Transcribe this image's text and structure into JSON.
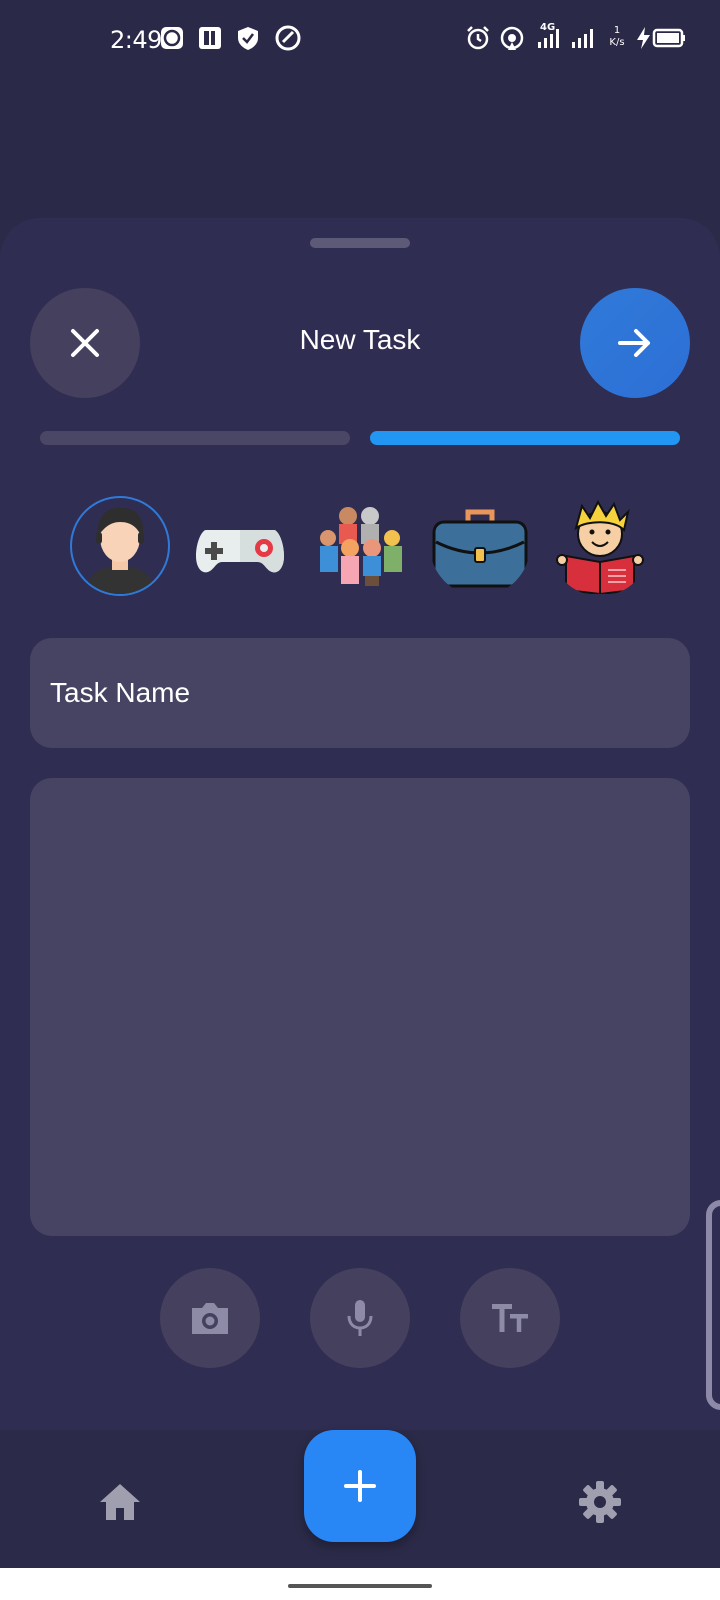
{
  "status_bar": {
    "time": "2:49",
    "network": "4G",
    "speed_value": "1",
    "speed_unit": "K/s",
    "icons": [
      "b-app-icon",
      "paytm-icon",
      "shield-icon",
      "vpn-icon",
      "alarm-icon",
      "hotspot-icon",
      "signal-icon",
      "signal-icon",
      "charging-icon",
      "battery-icon"
    ]
  },
  "sheet": {
    "title": "New Task",
    "close_icon": "close-icon",
    "next_icon": "arrow-right-icon",
    "progress": {
      "total_steps": 2,
      "current_step": 2
    },
    "categories": [
      {
        "name": "personal",
        "icon": "person-icon",
        "selected": true
      },
      {
        "name": "games",
        "icon": "gamepad-icon",
        "selected": false
      },
      {
        "name": "family",
        "icon": "family-icon",
        "selected": false
      },
      {
        "name": "work",
        "icon": "briefcase-icon",
        "selected": false
      },
      {
        "name": "study",
        "icon": "reading-icon",
        "selected": false
      }
    ],
    "task_name_placeholder": "Task Name",
    "task_body_placeholder": "",
    "media_buttons": [
      "camera-icon",
      "microphone-icon",
      "text-size-icon"
    ]
  },
  "bottom_nav": {
    "items": [
      "home-icon",
      "add-icon",
      "settings-icon"
    ]
  },
  "colors": {
    "background": "#2b2a48",
    "sheet": "#302d52",
    "field": "#474463",
    "accent": "#2196f3",
    "fab": "#2886f5"
  }
}
